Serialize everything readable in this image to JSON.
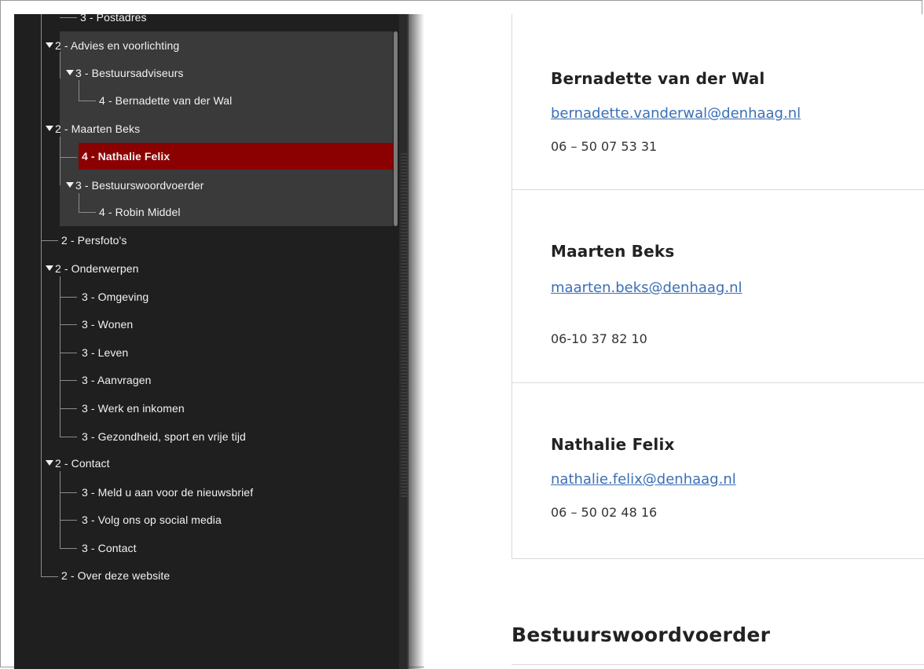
{
  "tree": {
    "items": [
      {
        "label": "3 - Postadres"
      },
      {
        "label": "2 - Advies en voorlichting"
      },
      {
        "label": "3 - Bestuursadviseurs"
      },
      {
        "label": "4 - Bernadette van der Wal"
      },
      {
        "label": "2 - Maarten Beks"
      },
      {
        "label": "4 - Nathalie Felix"
      },
      {
        "label": "3 - Bestuurswoordvoerder"
      },
      {
        "label": "4 - Robin Middel"
      },
      {
        "label": "2 - Persfoto's"
      },
      {
        "label": "2 - Onderwerpen"
      },
      {
        "label": "3 - Omgeving"
      },
      {
        "label": "3 - Wonen"
      },
      {
        "label": "3 - Leven"
      },
      {
        "label": "3 - Aanvragen"
      },
      {
        "label": "3 - Werk en inkomen"
      },
      {
        "label": "3 - Gezondheid, sport en vrije tijd"
      },
      {
        "label": "2 - Contact"
      },
      {
        "label": "3 - Meld u aan voor de nieuwsbrief"
      },
      {
        "label": "3 - Volg ons op social media"
      },
      {
        "label": "3 - Contact"
      },
      {
        "label": "2 - Over deze website"
      }
    ],
    "selected_label": "4 - Nathalie Felix"
  },
  "contacts": [
    {
      "name": "Bernadette van der Wal",
      "email": "bernadette.vanderwal@denhaag.nl",
      "phone": "06 – 50 07 53 31"
    },
    {
      "name": "Maarten Beks",
      "email": "maarten.beks@denhaag.nl",
      "phone": "06-10 37 82 10"
    },
    {
      "name": "Nathalie Felix",
      "email": "nathalie.felix@denhaag.nl",
      "phone": "06 – 50 02 48 16"
    }
  ],
  "section": {
    "heading": "Bestuurswoordvoerder"
  },
  "colors": {
    "tree_background": "#1f1f1f",
    "selected_row": "#8b0000",
    "link": "#3b6fb6"
  }
}
